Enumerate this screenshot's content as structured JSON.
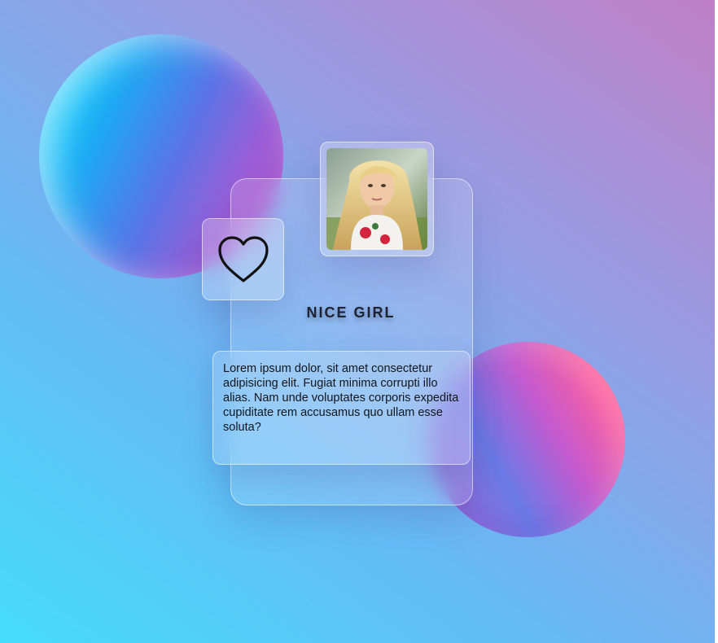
{
  "card": {
    "title": "NICE GIRL",
    "description": "Lorem ipsum dolor, sit amet consectetur adipisicing elit. Fugiat minima corrupti illo alias. Nam unde voluptates corporis expedita cupiditate rem accusamus quo ullam esse soluta?",
    "like_icon": "heart-icon",
    "photo": "profile-photo"
  },
  "colors": {
    "background_start": "#45dcfb",
    "background_end": "#c07fc7",
    "title_text": "#1f2230",
    "body_text": "#12151c"
  }
}
